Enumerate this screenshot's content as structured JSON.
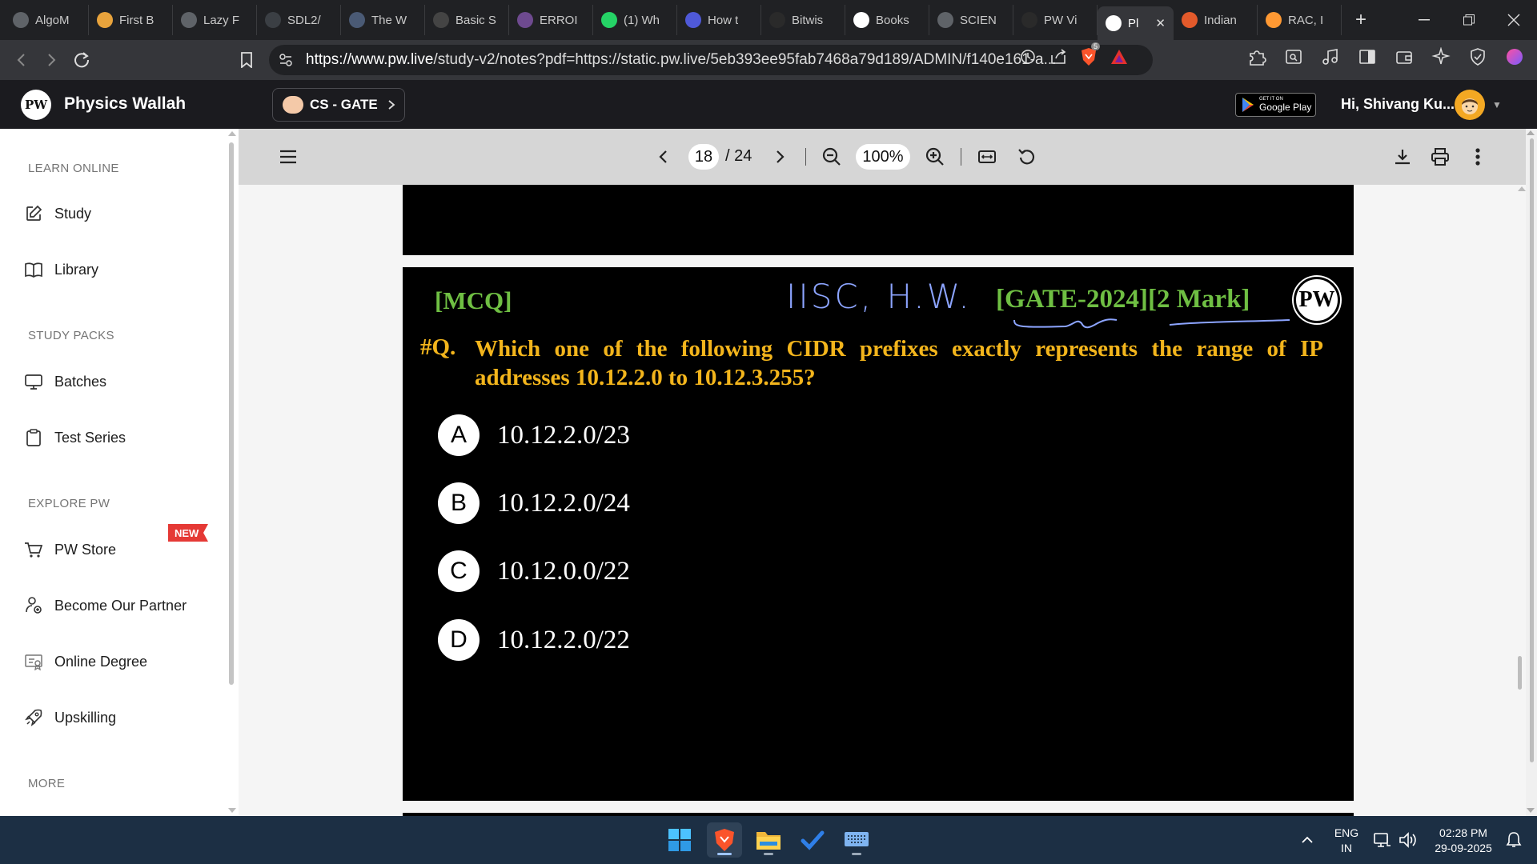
{
  "browser": {
    "tabs": [
      {
        "title": "AlgoM",
        "icon": "algomaster-icon",
        "color": "#5f6368"
      },
      {
        "title": "First B",
        "icon": "firstbad-icon",
        "color": "#e8a33c"
      },
      {
        "title": "Lazy F",
        "icon": "lazy-icon",
        "color": "#5f6368"
      },
      {
        "title": "SDL2/",
        "icon": "sdl-icon",
        "color": "#3b3f44"
      },
      {
        "title": "The W",
        "icon": "wordpress-icon",
        "color": "#4a5a75"
      },
      {
        "title": "Basic S",
        "icon": "basic-icon",
        "color": "#444"
      },
      {
        "title": "ERROI",
        "icon": "error-icon",
        "color": "#6e4a8f"
      },
      {
        "title": "(1) Wh",
        "icon": "whatsapp-icon",
        "color": "#25d366"
      },
      {
        "title": "How t",
        "icon": "howto-icon",
        "color": "#4f59d8"
      },
      {
        "title": "Bitwis",
        "icon": "geeks-icon",
        "color": "#2a2a2a"
      },
      {
        "title": "Books",
        "icon": "google-icon",
        "color": "#ffffff"
      },
      {
        "title": "SCIEN",
        "icon": "globe-icon",
        "color": "#5f6368"
      },
      {
        "title": "PW Vi",
        "icon": "pw-video-icon",
        "color": "#2a2a2a"
      },
      {
        "title": "Pl",
        "icon": "pw-icon",
        "color": "#ffffff",
        "active": true
      },
      {
        "title": "Indian",
        "icon": "indian-icon",
        "color": "#e35a2b"
      },
      {
        "title": "RAC, I",
        "icon": "india-flag-icon",
        "color": "#ff9933"
      }
    ],
    "new_tab": "+",
    "url_host": "https://www.pw.live",
    "url_rest": "/study-v2/notes?pdf=https://static.pw.live/5eb393ee95fab7468a79d189/ADMIN/f140e161-a...",
    "brave_badge": "5"
  },
  "header": {
    "brand": "Physics Wallah",
    "logo_text": "PW",
    "course": "CS - GATE",
    "gplay_small": "GET IT ON",
    "gplay_big": "Google Play",
    "greeting": "Hi, Shivang Ku..."
  },
  "sidebar": {
    "sections": [
      "LEARN ONLINE",
      "STUDY PACKS",
      "EXPLORE PW",
      "MORE"
    ],
    "items": [
      {
        "label": "Study",
        "icon": "edit-icon"
      },
      {
        "label": "Library",
        "icon": "book-icon"
      },
      {
        "label": "Batches",
        "icon": "monitor-icon"
      },
      {
        "label": "Test Series",
        "icon": "clipboard-icon"
      },
      {
        "label": "PW Store",
        "icon": "cart-icon"
      },
      {
        "label": "Become Our Partner",
        "icon": "partner-icon"
      },
      {
        "label": "Online Degree",
        "icon": "degree-icon"
      },
      {
        "label": "Upskilling",
        "icon": "rocket-icon"
      }
    ],
    "new_badge": "NEW"
  },
  "pdf": {
    "page": "18",
    "total": "/ 24",
    "zoom": "100%"
  },
  "slide": {
    "tag": "[MCQ]",
    "handwritten": "IISC, H.W.",
    "exam": "[GATE-2024][2 Mark]",
    "logo": "PW",
    "qnum": "#Q.",
    "question": "Which one of the following CIDR prefixes exactly represents the range of IP addresses 10.12.2.0 to 10.12.3.255?",
    "options": [
      {
        "letter": "A",
        "value": "10.12.2.0/23"
      },
      {
        "letter": "B",
        "value": "10.12.2.0/24"
      },
      {
        "letter": "C",
        "value": "10.12.0.0/22"
      },
      {
        "letter": "D",
        "value": "10.12.2.0/22"
      }
    ]
  },
  "taskbar": {
    "lang_top": "ENG",
    "lang_bottom": "IN",
    "time": "02:28 PM",
    "date": "29-09-2025"
  }
}
